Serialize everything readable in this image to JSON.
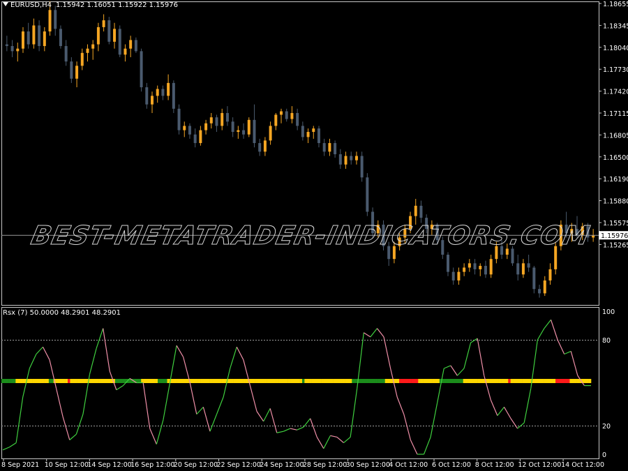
{
  "symbol": "EURUSD,H4",
  "ohlc": "1.15942 1.16051 1.15922 1.15976",
  "current_price": "1.15976",
  "current_price_value": 1.15976,
  "watermark": "BEST-METATRADER-INDICATORS.COM",
  "indicator_label": "Rsx (7) 50.0000 48.2901 48.2901",
  "colors": {
    "bull": "#f5a623",
    "bear": "#4a5a6e",
    "rsx_up": "#3fd03f",
    "rsx_down": "#ef8fa8",
    "green": "#1b8c1b",
    "yellow": "#ffd700",
    "red": "#ff1a1a"
  },
  "price_axis": [
    "1.18655",
    "1.18345",
    "1.18040",
    "1.17730",
    "1.17420",
    "1.17115",
    "1.16805",
    "1.16500",
    "1.16190",
    "1.15880",
    "1.15575",
    "1.15265"
  ],
  "ind_axis": [
    "100",
    "80",
    "20",
    "0"
  ],
  "ind_levels": [
    80,
    20
  ],
  "time_axis": [
    "8 Sep 2021",
    "10 Sep 12:00",
    "14 Sep 12:00",
    "16 Sep 12:00",
    "20 Sep 12:00",
    "22 Sep 12:00",
    "24 Sep 12:00",
    "28 Sep 12:00",
    "30 Sep 12:00",
    "4 Oct 12:00",
    "6 Oct 12:00",
    "8 Oct 12:00",
    "12 Oct 12:00",
    "14 Oct 12:00"
  ],
  "chart_data": {
    "type": "candlestick",
    "price_range": [
      1.15165,
      1.187
    ],
    "candles": [
      [
        1.182,
        1.183,
        1.1812,
        1.1818
      ],
      [
        1.1818,
        1.1825,
        1.1805,
        1.1812
      ],
      [
        1.1812,
        1.1822,
        1.18,
        1.1815
      ],
      [
        1.1815,
        1.184,
        1.181,
        1.1835
      ],
      [
        1.1835,
        1.1845,
        1.1815,
        1.182
      ],
      [
        1.182,
        1.185,
        1.1815,
        1.1842
      ],
      [
        1.1842,
        1.1848,
        1.1812,
        1.1818
      ],
      [
        1.1818,
        1.184,
        1.1812,
        1.1835
      ],
      [
        1.1835,
        1.187,
        1.183,
        1.186
      ],
      [
        1.186,
        1.1865,
        1.183,
        1.1838
      ],
      [
        1.1838,
        1.1842,
        1.1815,
        1.1818
      ],
      [
        1.1818,
        1.1825,
        1.1795,
        1.18
      ],
      [
        1.18,
        1.1805,
        1.1775,
        1.178
      ],
      [
        1.178,
        1.18,
        1.177,
        1.1795
      ],
      [
        1.1795,
        1.1815,
        1.179,
        1.181
      ],
      [
        1.181,
        1.182,
        1.18,
        1.1815
      ],
      [
        1.1815,
        1.1825,
        1.1802,
        1.182
      ],
      [
        1.182,
        1.1845,
        1.1812,
        1.184
      ],
      [
        1.184,
        1.1855,
        1.1835,
        1.1848
      ],
      [
        1.1848,
        1.1852,
        1.182,
        1.1823
      ],
      [
        1.1823,
        1.1845,
        1.1815,
        1.1838
      ],
      [
        1.1838,
        1.1842,
        1.1805,
        1.1808
      ],
      [
        1.1808,
        1.182,
        1.18,
        1.1815
      ],
      [
        1.1815,
        1.183,
        1.1805,
        1.1825
      ],
      [
        1.1825,
        1.1828,
        1.181,
        1.1812
      ],
      [
        1.1812,
        1.1815,
        1.1765,
        1.177
      ],
      [
        1.177,
        1.1775,
        1.1745,
        1.175
      ],
      [
        1.175,
        1.1765,
        1.174,
        1.176
      ],
      [
        1.176,
        1.1772,
        1.1752,
        1.1768
      ],
      [
        1.1768,
        1.1772,
        1.1755,
        1.176
      ],
      [
        1.176,
        1.1785,
        1.1755,
        1.1775
      ],
      [
        1.1775,
        1.1778,
        1.174,
        1.1745
      ],
      [
        1.1745,
        1.175,
        1.1715,
        1.172
      ],
      [
        1.172,
        1.173,
        1.1712,
        1.1725
      ],
      [
        1.1725,
        1.1728,
        1.171,
        1.1715
      ],
      [
        1.1715,
        1.1722,
        1.17,
        1.1705
      ],
      [
        1.1705,
        1.1725,
        1.1702,
        1.172
      ],
      [
        1.172,
        1.1732,
        1.1715,
        1.1728
      ],
      [
        1.1728,
        1.174,
        1.1722,
        1.1735
      ],
      [
        1.1735,
        1.1738,
        1.1718,
        1.1725
      ],
      [
        1.1725,
        1.1745,
        1.172,
        1.174
      ],
      [
        1.174,
        1.1748,
        1.1725,
        1.173
      ],
      [
        1.173,
        1.1735,
        1.1712,
        1.1718
      ],
      [
        1.1718,
        1.1725,
        1.171,
        1.172
      ],
      [
        1.172,
        1.1728,
        1.171,
        1.1715
      ],
      [
        1.1715,
        1.1735,
        1.1712,
        1.1732
      ],
      [
        1.1732,
        1.175,
        1.17,
        1.1705
      ],
      [
        1.1705,
        1.171,
        1.169,
        1.1695
      ],
      [
        1.1695,
        1.1712,
        1.169,
        1.1708
      ],
      [
        1.1708,
        1.173,
        1.1703,
        1.1725
      ],
      [
        1.1725,
        1.174,
        1.172,
        1.1738
      ],
      [
        1.1738,
        1.1745,
        1.1728,
        1.1742
      ],
      [
        1.1742,
        1.1745,
        1.173,
        1.1733
      ],
      [
        1.1733,
        1.1748,
        1.1728,
        1.174
      ],
      [
        1.174,
        1.1745,
        1.172,
        1.1725
      ],
      [
        1.1725,
        1.173,
        1.1708,
        1.1712
      ],
      [
        1.1712,
        1.1722,
        1.1705,
        1.1718
      ],
      [
        1.1718,
        1.1725,
        1.171,
        1.1722
      ],
      [
        1.1722,
        1.1725,
        1.17,
        1.1705
      ],
      [
        1.1705,
        1.171,
        1.169,
        1.1695
      ],
      [
        1.1695,
        1.171,
        1.169,
        1.1705
      ],
      [
        1.1705,
        1.1708,
        1.1688,
        1.1692
      ],
      [
        1.1692,
        1.1698,
        1.1675,
        1.168
      ],
      [
        1.168,
        1.1695,
        1.1675,
        1.169
      ],
      [
        1.169,
        1.1695,
        1.168,
        1.1685
      ],
      [
        1.1685,
        1.1695,
        1.168,
        1.169
      ],
      [
        1.169,
        1.1695,
        1.166,
        1.1665
      ],
      [
        1.1665,
        1.167,
        1.162,
        1.1625
      ],
      [
        1.1625,
        1.163,
        1.1595,
        1.16
      ],
      [
        1.16,
        1.1615,
        1.1595,
        1.161
      ],
      [
        1.161,
        1.1615,
        1.158,
        1.1585
      ],
      [
        1.1585,
        1.159,
        1.1562,
        1.157
      ],
      [
        1.157,
        1.159,
        1.1565,
        1.1585
      ],
      [
        1.1585,
        1.16,
        1.158,
        1.1595
      ],
      [
        1.1595,
        1.161,
        1.1588,
        1.1605
      ],
      [
        1.1605,
        1.1625,
        1.16,
        1.162
      ],
      [
        1.162,
        1.164,
        1.161,
        1.1632
      ],
      [
        1.1632,
        1.1638,
        1.1612,
        1.1618
      ],
      [
        1.1618,
        1.1622,
        1.16,
        1.1605
      ],
      [
        1.1605,
        1.1615,
        1.1598,
        1.161
      ],
      [
        1.161,
        1.1612,
        1.1588,
        1.1592
      ],
      [
        1.1592,
        1.1596,
        1.157,
        1.1575
      ],
      [
        1.1575,
        1.1578,
        1.155,
        1.1555
      ],
      [
        1.1555,
        1.156,
        1.154,
        1.1545
      ],
      [
        1.1545,
        1.156,
        1.154,
        1.1555
      ],
      [
        1.1555,
        1.1565,
        1.155,
        1.156
      ],
      [
        1.156,
        1.157,
        1.1555,
        1.1565
      ],
      [
        1.1565,
        1.157,
        1.1552,
        1.1558
      ],
      [
        1.1558,
        1.1565,
        1.155,
        1.1562
      ],
      [
        1.1562,
        1.1568,
        1.1548,
        1.1552
      ],
      [
        1.1552,
        1.1575,
        1.1548,
        1.157
      ],
      [
        1.157,
        1.159,
        1.1565,
        1.1585
      ],
      [
        1.1585,
        1.1592,
        1.157,
        1.1575
      ],
      [
        1.1575,
        1.1588,
        1.157,
        1.1582
      ],
      [
        1.1582,
        1.1585,
        1.1562,
        1.1565
      ],
      [
        1.1565,
        1.1575,
        1.1545,
        1.1552
      ],
      [
        1.1552,
        1.157,
        1.1548,
        1.1565
      ],
      [
        1.1565,
        1.1575,
        1.1555,
        1.156
      ],
      [
        1.156,
        1.1562,
        1.153,
        1.1535
      ],
      [
        1.1535,
        1.154,
        1.1525,
        1.153
      ],
      [
        1.153,
        1.155,
        1.1527,
        1.1545
      ],
      [
        1.1545,
        1.1565,
        1.154,
        1.1558
      ],
      [
        1.1558,
        1.159,
        1.1552,
        1.1585
      ],
      [
        1.1585,
        1.1615,
        1.158,
        1.161
      ],
      [
        1.161,
        1.1625,
        1.1595,
        1.16
      ],
      [
        1.16,
        1.1612,
        1.159,
        1.1605
      ],
      [
        1.1605,
        1.162,
        1.1595,
        1.1598
      ],
      [
        1.1598,
        1.1612,
        1.1592,
        1.1608
      ],
      [
        1.1608,
        1.1612,
        1.159,
        1.1595
      ],
      [
        1.1595,
        1.1605,
        1.159,
        1.15976
      ]
    ],
    "rsx": [
      3,
      5,
      8,
      40,
      60,
      70,
      75,
      66,
      46,
      26,
      10,
      14,
      28,
      56,
      74,
      88,
      58,
      45,
      48,
      53,
      50,
      50,
      18,
      7,
      24,
      50,
      76,
      68,
      50,
      28,
      33,
      16,
      28,
      40,
      60,
      75,
      66,
      48,
      30,
      23,
      32,
      15,
      16,
      18,
      17,
      19,
      25,
      12,
      4,
      13,
      12,
      8,
      12,
      46,
      85,
      82,
      88,
      82,
      60,
      40,
      28,
      10,
      0,
      0,
      12,
      36,
      60,
      62,
      55,
      60,
      78,
      81,
      55,
      38,
      27,
      33,
      25,
      18,
      22,
      46,
      80,
      88,
      94,
      80,
      70,
      72,
      55,
      48,
      48
    ],
    "bar": "GGGGGGYYYYYYYYYYYYYYGGYYYYYYRYYYYYYYYYYYYYYYYYYYGGGGGGGGGGGYYYYYYYGGGGYYYYYYYYYYYYYYYYYYYYYYYYYYYYYYYYYYYYYYYYYYYYYYYYYYYYYYYYYGYYYYYYYYYYYYYYYYYYYYGGGGGGGGGGGGGGYYYYYYRRRRRRRRYYYYYYYYYGGGGGGGGGGYYYYYYYYYYYYYYYYYYYRYYYYYYYYYYYYYYYYYYYRRRRRRYYYYYYYYY"
  }
}
